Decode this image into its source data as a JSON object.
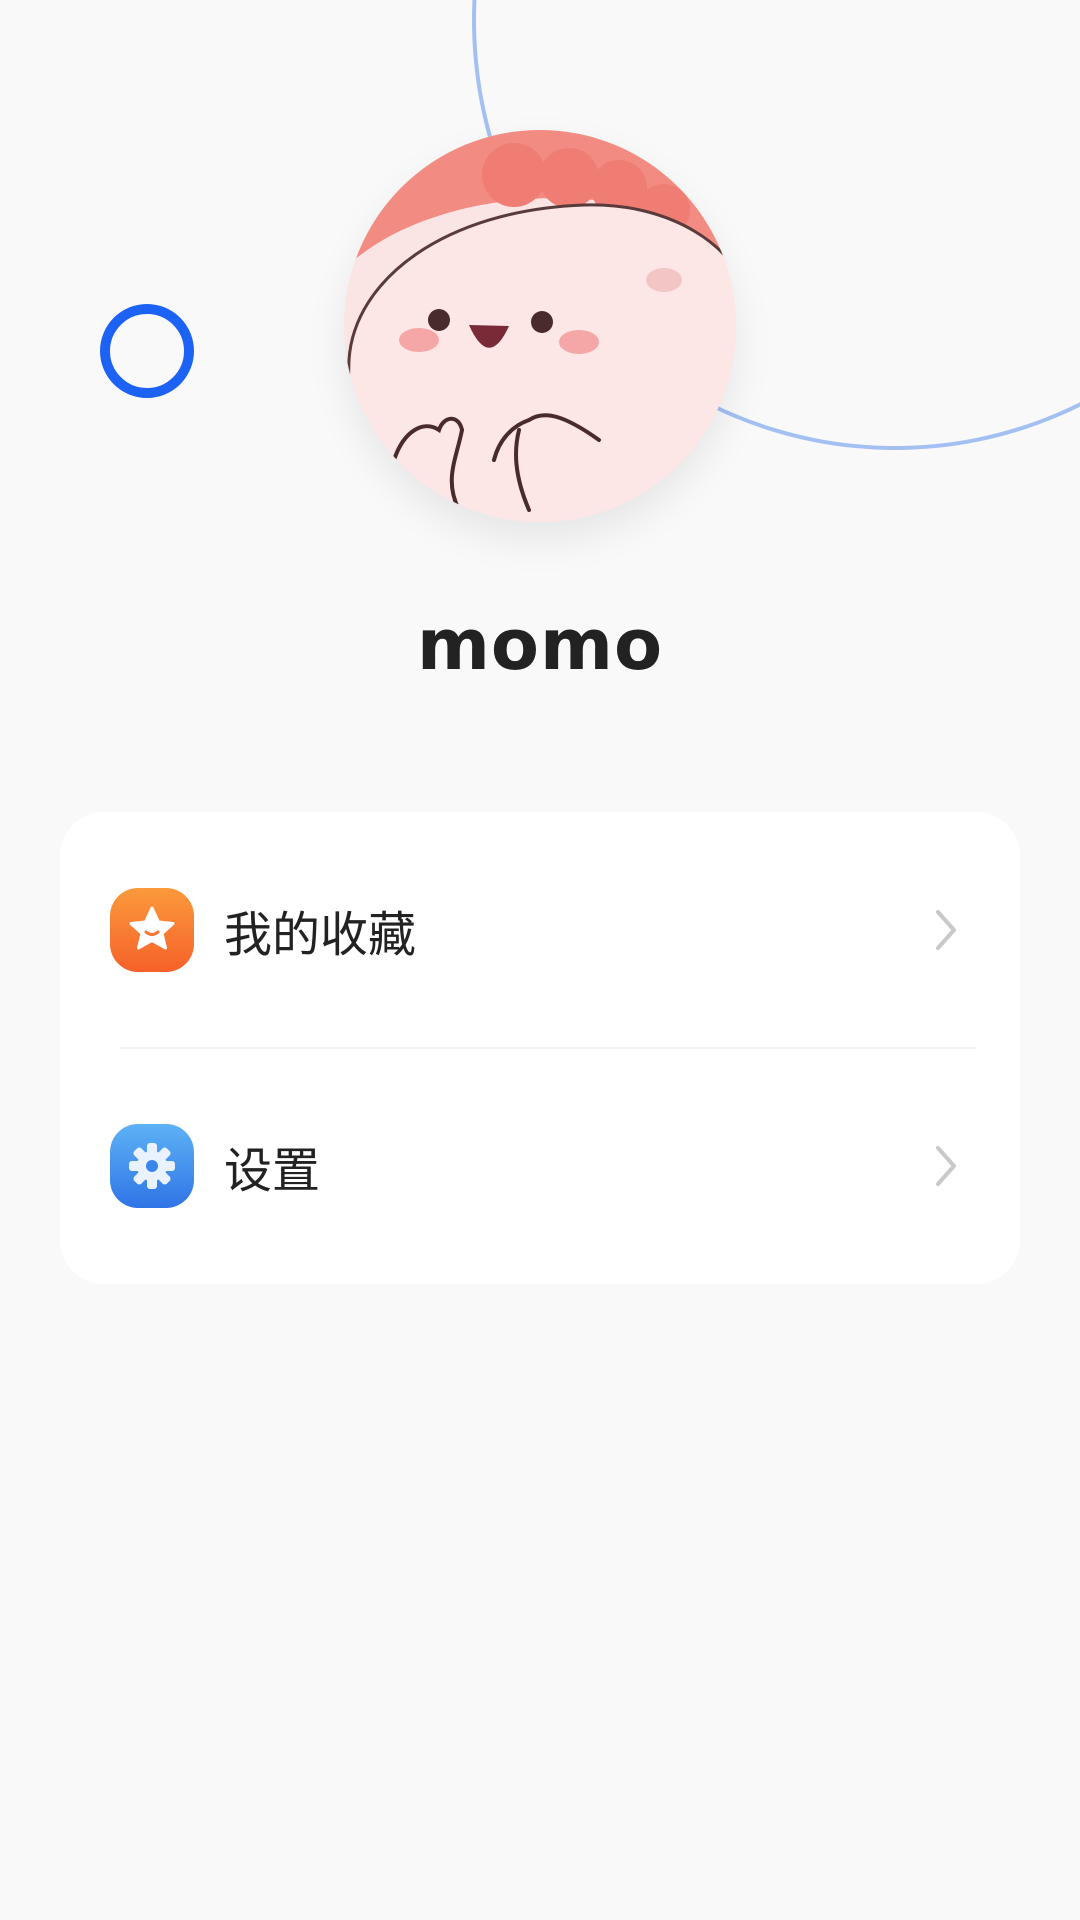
{
  "profile": {
    "username": "momo"
  },
  "menu": {
    "items": [
      {
        "label": "我的收藏",
        "icon": "star-icon",
        "icon_color": "#f96d2a"
      },
      {
        "label": "设置",
        "icon": "gear-icon",
        "icon_color": "#3b86ec"
      }
    ]
  },
  "colors": {
    "background": "#f9f9fa",
    "accent_ring": "#1c62f4",
    "decor_arc": "#a4c0f2",
    "card": "#ffffff",
    "text": "#222222",
    "chevron": "#c9c9cc"
  }
}
